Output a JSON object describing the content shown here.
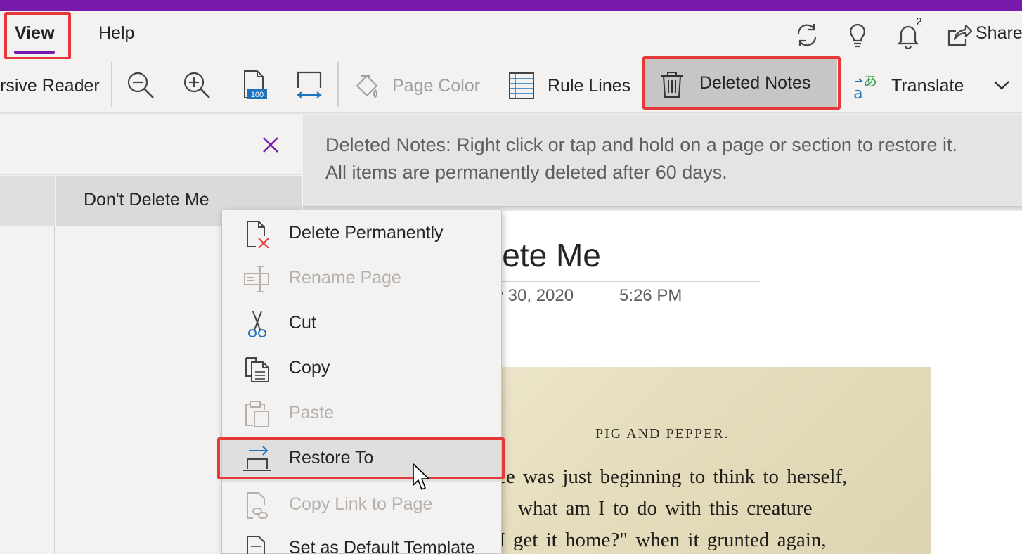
{
  "title_bar": {
    "color": "#7719aa"
  },
  "tabs": {
    "view_label": "View",
    "help_label": "Help",
    "notification_count": "2",
    "share_label": "Share"
  },
  "ribbon": {
    "immersive_reader_label": "rsive Reader",
    "page_color_label": "Page Color",
    "rule_lines_label": "Rule Lines",
    "deleted_notes_label": "Deleted Notes",
    "translate_label": "Translate",
    "icons": [
      "zoom-out-icon",
      "zoom-in-icon",
      "zoom-100-icon",
      "page-width-icon",
      "page-color-icon",
      "rule-lines-icon",
      "trash-icon",
      "translate-icon",
      "chevron-down-icon"
    ]
  },
  "info_bar": {
    "line1": "Deleted Notes: Right click or tap and hold on a page or section to restore it.",
    "line2": "All items are permanently deleted after 60 days."
  },
  "page_list": {
    "selected_page": "Don't Delete Me"
  },
  "page": {
    "title_visible": "lete Me",
    "date_visible": "y 30, 2020",
    "time": "5:26 PM"
  },
  "book": {
    "heading": "PIG AND PEPPER.",
    "line1": "ce was just beginning to think to herself,",
    "line2": "what am I to do with this creature",
    "line3": "I get it home?\" when it grunted again,"
  },
  "context_menu": {
    "items": [
      {
        "label": "Delete Permanently",
        "enabled": true
      },
      {
        "label": "Rename Page",
        "enabled": false
      },
      {
        "label": "Cut",
        "enabled": true
      },
      {
        "label": "Copy",
        "enabled": true
      },
      {
        "label": "Paste",
        "enabled": false
      },
      {
        "label": "Restore To",
        "enabled": true
      },
      {
        "label": "Copy Link to Page",
        "enabled": false
      },
      {
        "label": "Set as Default Template",
        "enabled": true
      }
    ]
  },
  "colors": {
    "accent": "#7719aa",
    "highlight_box": "#e5383b"
  }
}
